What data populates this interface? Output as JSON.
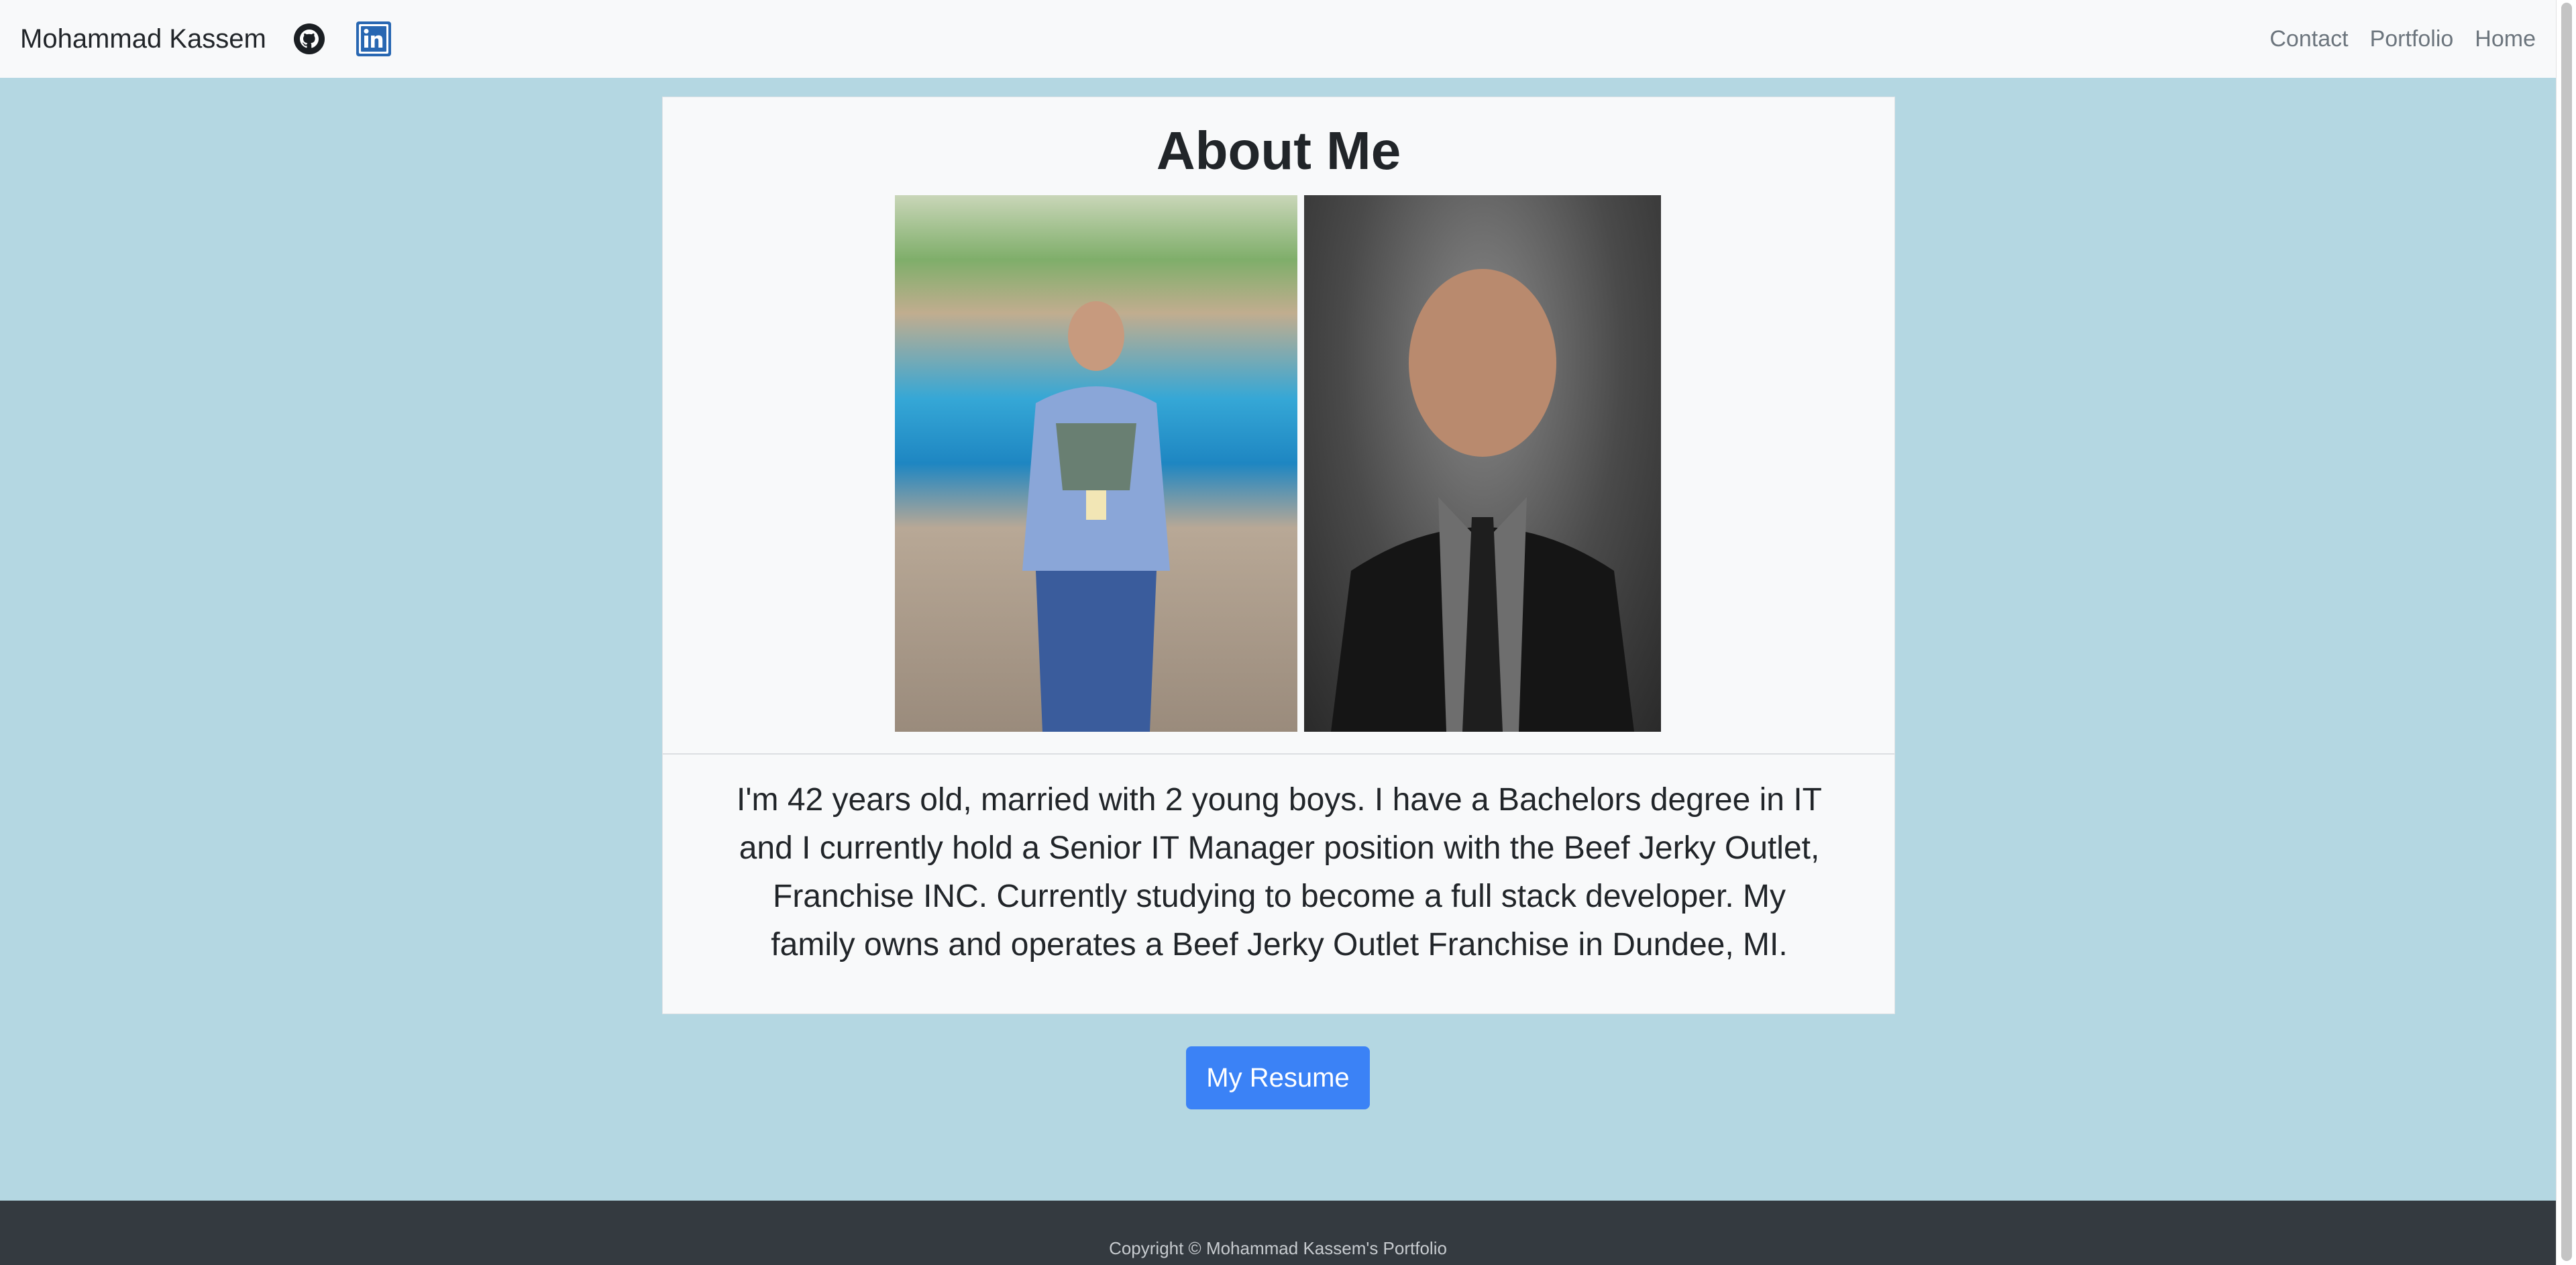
{
  "navbar": {
    "brand": "Mohammad Kassem",
    "icons": [
      "github-icon",
      "linkedin-icon"
    ],
    "links": [
      "Contact",
      "Portfolio",
      "Home"
    ]
  },
  "about": {
    "title": "About Me",
    "bio": "I'm 42 years old, married with 2 young boys. I have a Bachelors degree in IT and I currently hold a Senior IT Manager position with the Beef Jerky Outlet, Franchise INC. Currently studying to become a full stack developer. My family owns and operates a Beef Jerky Outlet Franchise in Dundee, MI."
  },
  "resume_button": "My Resume",
  "footer": {
    "copyright": "Copyright © Mohammad Kassem's Portfolio"
  },
  "colors": {
    "background": "#b4d7e2",
    "navbar": "#f8f9fa",
    "button": "#3b82f6",
    "footer": "#343a40",
    "linkedin": "#2867b2"
  }
}
